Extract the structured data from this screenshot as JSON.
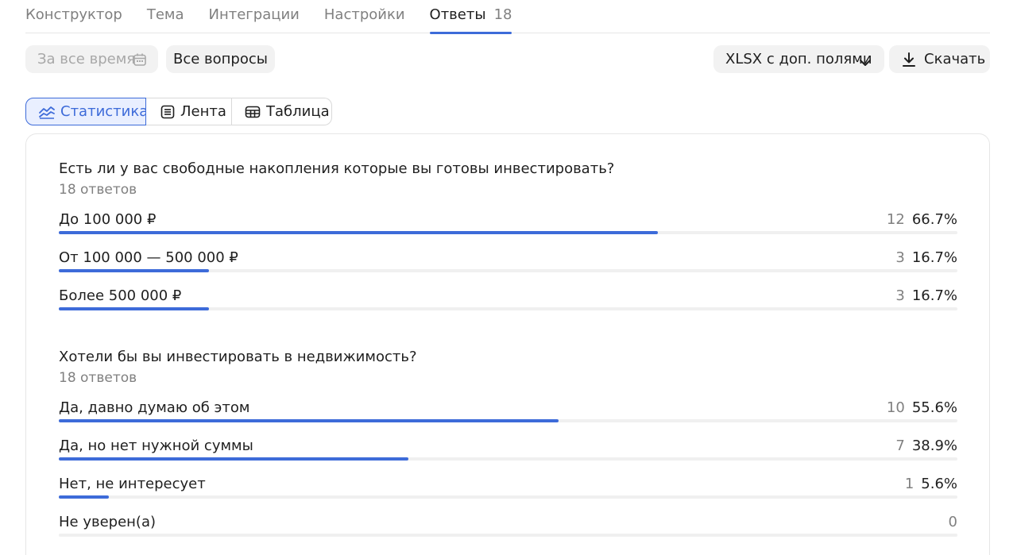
{
  "tabs": [
    {
      "label": "Конструктор"
    },
    {
      "label": "Тема"
    },
    {
      "label": "Интеграции"
    },
    {
      "label": "Настройки"
    },
    {
      "label": "Ответы",
      "count": "18",
      "active": true
    }
  ],
  "toolbar": {
    "date_filter_placeholder": "За все время",
    "questions_filter": "Все вопросы",
    "export_format": "XLSX с доп. полями",
    "download_label": "Скачать"
  },
  "views": [
    {
      "label": "Статистика",
      "icon": "chart-line-icon",
      "active": true
    },
    {
      "label": "Лента",
      "icon": "list-icon",
      "active": false
    },
    {
      "label": "Таблица",
      "icon": "table-icon",
      "active": false
    }
  ],
  "accent_color": "#3d6bd9",
  "questions": [
    {
      "title": "Есть ли у вас свободные накопления которые вы готовы инвестировать?",
      "responses": "18 ответов",
      "answers": [
        {
          "label": "До 100 000 ₽",
          "count": "12",
          "percent": "66.7%",
          "share": 0.667
        },
        {
          "label": "От 100 000 — 500 000 ₽",
          "count": "3",
          "percent": "16.7%",
          "share": 0.167
        },
        {
          "label": "Более 500 000 ₽",
          "count": "3",
          "percent": "16.7%",
          "share": 0.167
        }
      ]
    },
    {
      "title": "Хотели бы вы инвестировать в недвижимость?",
      "responses": "18 ответов",
      "answers": [
        {
          "label": "Да, давно думаю об этом",
          "count": "10",
          "percent": "55.6%",
          "share": 0.556
        },
        {
          "label": "Да, но нет нужной суммы",
          "count": "7",
          "percent": "38.9%",
          "share": 0.389
        },
        {
          "label": "Нет, не интересует",
          "count": "1",
          "percent": "5.6%",
          "share": 0.056
        },
        {
          "label": "Не уверен(а)",
          "count": "0",
          "percent": "",
          "share": 0
        }
      ]
    }
  ]
}
